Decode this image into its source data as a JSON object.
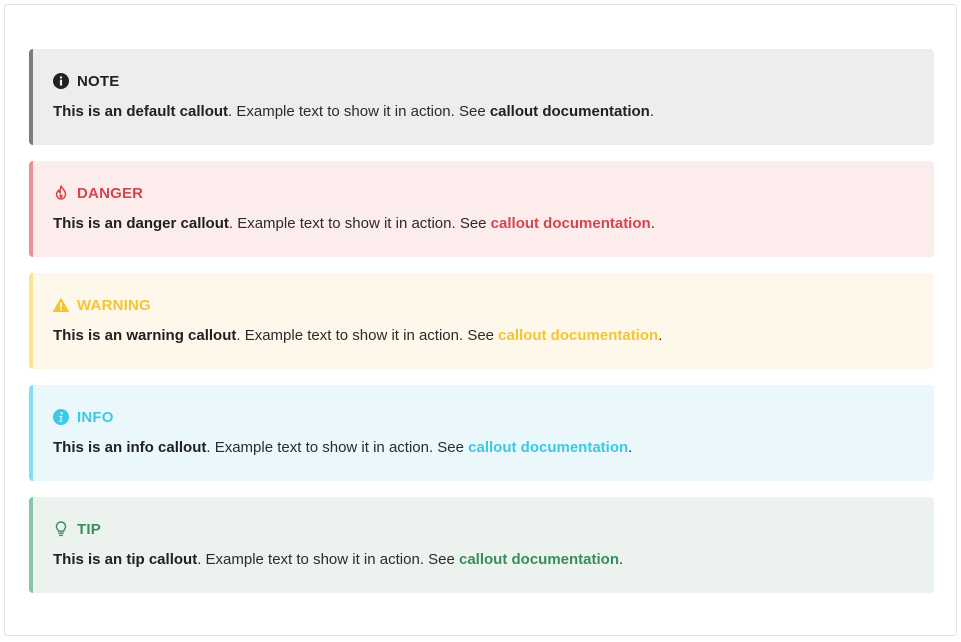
{
  "callouts": [
    {
      "title": "NOTE",
      "icon": "info-circle-icon",
      "lead": "This is an default callout",
      "text": ". Example text to show it in action. See ",
      "link": "callout documentation",
      "end": ".",
      "accent": "#212121"
    },
    {
      "title": "DANGER",
      "icon": "fire-icon",
      "lead": "This is an danger callout",
      "text": ". Example text to show it in action. See ",
      "link": "callout documentation",
      "end": ".",
      "accent": "#d6444e"
    },
    {
      "title": "WARNING",
      "icon": "warning-triangle-icon",
      "lead": "This is an warning callout",
      "text": ". Example text to show it in action. See ",
      "link": "callout documentation",
      "end": ".",
      "accent": "#f5c431"
    },
    {
      "title": "INFO",
      "icon": "info-circle-icon",
      "lead": "This is an info callout",
      "text": ". Example text to show it in action. See ",
      "link": "callout documentation",
      "end": ".",
      "accent": "#3bc9e6"
    },
    {
      "title": "TIP",
      "icon": "lightbulb-icon",
      "lead": "This is an tip callout",
      "text": ". Example text to show it in action. See ",
      "link": "callout documentation",
      "end": ".",
      "accent": "#3a8c5c"
    }
  ]
}
